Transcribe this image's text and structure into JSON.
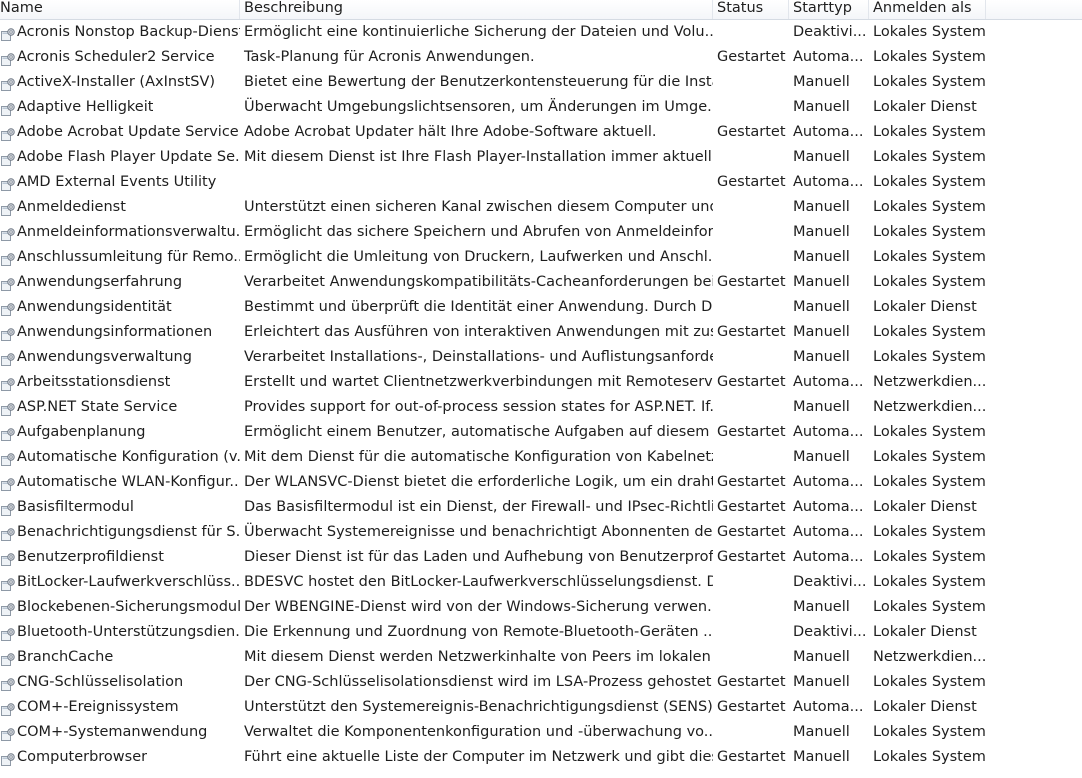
{
  "columns": {
    "name": "Name",
    "description": "Beschreibung",
    "status": "Status",
    "startup": "Starttyp",
    "logon": "Anmelden als"
  },
  "rows": [
    {
      "name": "Acronis Nonstop Backup-Dienst",
      "description": "Ermöglicht eine kontinuierliche Sicherung der Dateien und Volu...",
      "status": "",
      "startup": "Deaktivi...",
      "logon": "Lokales System"
    },
    {
      "name": "Acronis Scheduler2 Service",
      "description": "Task-Planung für Acronis Anwendungen.",
      "status": "Gestartet",
      "startup": "Automa...",
      "logon": "Lokales System"
    },
    {
      "name": "ActiveX-Installer (AxInstSV)",
      "description": "Bietet eine Bewertung der Benutzerkontensteuerung für die Instal...",
      "status": "",
      "startup": "Manuell",
      "logon": "Lokales System"
    },
    {
      "name": "Adaptive Helligkeit",
      "description": "Überwacht Umgebungslichtsensoren, um Änderungen im Umge...",
      "status": "",
      "startup": "Manuell",
      "logon": "Lokaler Dienst"
    },
    {
      "name": "Adobe Acrobat Update Service",
      "description": "Adobe Acrobat Updater hält Ihre Adobe-Software aktuell.",
      "status": "Gestartet",
      "startup": "Automa...",
      "logon": "Lokales System"
    },
    {
      "name": "Adobe Flash Player Update Se...",
      "description": "Mit diesem Dienst ist Ihre Flash Player-Installation immer aktuell ...",
      "status": "",
      "startup": "Manuell",
      "logon": "Lokales System"
    },
    {
      "name": "AMD External Events Utility",
      "description": "",
      "status": "Gestartet",
      "startup": "Automa...",
      "logon": "Lokales System"
    },
    {
      "name": "Anmeldedienst",
      "description": "Unterstützt einen sicheren Kanal zwischen diesem Computer und...",
      "status": "",
      "startup": "Manuell",
      "logon": "Lokales System"
    },
    {
      "name": "Anmeldeinformationsverwaltu...",
      "description": "Ermöglicht das sichere Speichern und Abrufen von Anmeldeinfor...",
      "status": "",
      "startup": "Manuell",
      "logon": "Lokales System"
    },
    {
      "name": "Anschlussumleitung für Remo...",
      "description": "Ermöglicht die Umleitung von Druckern, Laufwerken und Anschl...",
      "status": "",
      "startup": "Manuell",
      "logon": "Lokales System"
    },
    {
      "name": "Anwendungserfahrung",
      "description": "Verarbeitet Anwendungskompatibilitäts-Cacheanforderungen bei...",
      "status": "Gestartet",
      "startup": "Manuell",
      "logon": "Lokales System"
    },
    {
      "name": "Anwendungsidentität",
      "description": "Bestimmt und überprüft die Identität einer Anwendung. Durch De...",
      "status": "",
      "startup": "Manuell",
      "logon": "Lokaler Dienst"
    },
    {
      "name": "Anwendungsinformationen",
      "description": "Erleichtert das Ausführen von interaktiven Anwendungen mit zus...",
      "status": "Gestartet",
      "startup": "Manuell",
      "logon": "Lokales System"
    },
    {
      "name": "Anwendungsverwaltung",
      "description": "Verarbeitet Installations-, Deinstallations- und Auflistungsanforde...",
      "status": "",
      "startup": "Manuell",
      "logon": "Lokales System"
    },
    {
      "name": "Arbeitsstationsdienst",
      "description": "Erstellt und wartet Clientnetzwerkverbindungen mit Remoteserve...",
      "status": "Gestartet",
      "startup": "Automa...",
      "logon": "Netzwerkdien..."
    },
    {
      "name": "ASP.NET State Service",
      "description": "Provides support for out-of-process session states for ASP.NET. If...",
      "status": "",
      "startup": "Manuell",
      "logon": "Netzwerkdien..."
    },
    {
      "name": "Aufgabenplanung",
      "description": "Ermöglicht einem Benutzer, automatische Aufgaben auf diesem C...",
      "status": "Gestartet",
      "startup": "Automa...",
      "logon": "Lokales System"
    },
    {
      "name": "Automatische Konfiguration (v...",
      "description": "Mit dem Dienst für die automatische Konfiguration von Kabelnetz...",
      "status": "",
      "startup": "Manuell",
      "logon": "Lokales System"
    },
    {
      "name": "Automatische WLAN-Konfigur...",
      "description": "Der WLANSVC-Dienst bietet die erforderliche Logik, um ein draht...",
      "status": "Gestartet",
      "startup": "Automa...",
      "logon": "Lokales System"
    },
    {
      "name": "Basisfiltermodul",
      "description": "Das Basisfiltermodul ist ein Dienst, der Firewall- und IPsec-Richtli...",
      "status": "Gestartet",
      "startup": "Automa...",
      "logon": "Lokaler Dienst"
    },
    {
      "name": "Benachrichtigungsdienst für S...",
      "description": "Überwacht Systemereignisse und benachrichtigt Abonnenten des...",
      "status": "Gestartet",
      "startup": "Automa...",
      "logon": "Lokales System"
    },
    {
      "name": "Benutzerprofildienst",
      "description": "Dieser Dienst ist für das Laden und Aufhebung von Benutzerprofi...",
      "status": "Gestartet",
      "startup": "Automa...",
      "logon": "Lokales System"
    },
    {
      "name": "BitLocker-Laufwerkverschlüss...",
      "description": "BDESVC hostet den BitLocker-Laufwerkverschlüsselungsdienst. D...",
      "status": "",
      "startup": "Deaktivi...",
      "logon": "Lokales System"
    },
    {
      "name": "Blockebenen-Sicherungsmodul",
      "description": "Der WBENGINE-Dienst wird von der Windows-Sicherung verwen...",
      "status": "",
      "startup": "Manuell",
      "logon": "Lokales System"
    },
    {
      "name": "Bluetooth-Unterstützungsdien...",
      "description": "Die Erkennung und Zuordnung von Remote-Bluetooth-Geräten ...",
      "status": "",
      "startup": "Deaktivi...",
      "logon": "Lokaler Dienst"
    },
    {
      "name": "BranchCache",
      "description": "Mit diesem Dienst werden Netzwerkinhalte von Peers im lokalen ...",
      "status": "",
      "startup": "Manuell",
      "logon": "Netzwerkdien..."
    },
    {
      "name": "CNG-Schlüsselisolation",
      "description": "Der CNG-Schlüsselisolationsdienst wird im LSA-Prozess gehostet...",
      "status": "Gestartet",
      "startup": "Manuell",
      "logon": "Lokales System"
    },
    {
      "name": "COM+-Ereignissystem",
      "description": "Unterstützt den Systemereignis-Benachrichtigungsdienst (SENS), ...",
      "status": "Gestartet",
      "startup": "Automa...",
      "logon": "Lokaler Dienst"
    },
    {
      "name": "COM+-Systemanwendung",
      "description": "Verwaltet die Komponentenkonfiguration und -überwachung vo...",
      "status": "",
      "startup": "Manuell",
      "logon": "Lokales System"
    },
    {
      "name": "Computerbrowser",
      "description": "Führt eine aktuelle Liste der Computer im Netzwerk und gibt dies...",
      "status": "Gestartet",
      "startup": "Manuell",
      "logon": "Lokales System"
    }
  ]
}
